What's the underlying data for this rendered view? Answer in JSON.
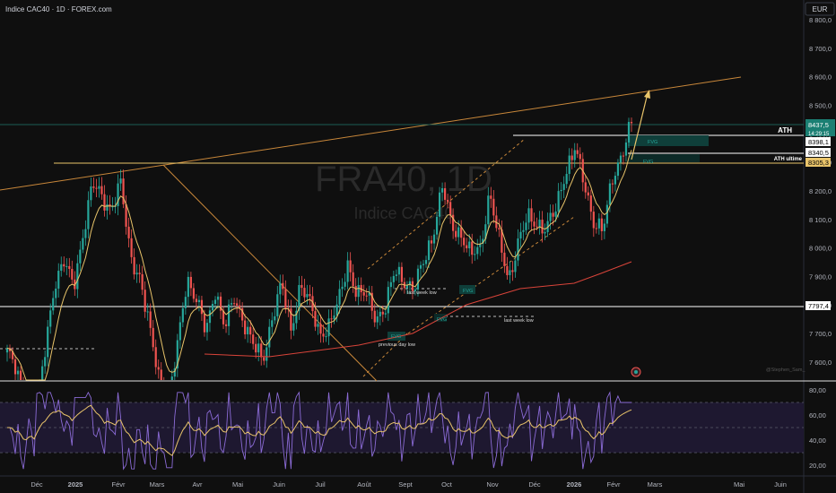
{
  "header": {
    "symbol_title": "Indice CAC40 · 1D · FOREX.com",
    "currency": "EUR"
  },
  "watermark": {
    "symbol": "FRA40, 1D",
    "name": "Indice CAC40"
  },
  "credit": "@Stephen_Sam_",
  "colors": {
    "bg": "#0f0f0f",
    "up": "#26a69a",
    "down": "#ef5350",
    "ma_fast": "#e9c46a",
    "ma_slow": "#d9443a",
    "trend": "#c8873a",
    "level": "#ffffff",
    "ath_line": "#e9c46a",
    "rsi": "#8b6bd6",
    "rsi_ma": "#e9c46a",
    "rsi_band": "#2a2140",
    "badge_green": "#1b7f73"
  },
  "chart_data": [
    {
      "type": "candlestick",
      "title": "FRA40, 1D",
      "y_axis_ticks": [
        "8 800,0",
        "8 700,0",
        "8 600,0",
        "8 500,0",
        "8 400,0",
        "8 300,0",
        "8 200,0",
        "8 100,0",
        "8 000,0",
        "7 900,0",
        "7 800,0",
        "7 700,0",
        "7 600,0"
      ],
      "x_axis_ticks": [
        "Déc",
        "2025",
        "Févr",
        "Mars",
        "Avr",
        "Mai",
        "Juin",
        "Juil",
        "Août",
        "Sept",
        "Oct",
        "Nov",
        "Déc",
        "2026",
        "Févr",
        "Mars",
        "Mai",
        "Juin"
      ],
      "ylim": [
        7535,
        8820
      ],
      "price_labels": [
        {
          "text": "8437,5",
          "value": 8437.5,
          "color": "#26a69a"
        },
        {
          "text": "14:29:15",
          "value": 8412,
          "color": "#26a69a"
        },
        {
          "text": "8398,1",
          "value": 8398.1,
          "color": "#ffffff"
        },
        {
          "text": "8340,5",
          "value": 8340.5,
          "color": "#ffffff"
        },
        {
          "text": "8305,3",
          "value": 8305.3,
          "color": "#e9c46a"
        },
        {
          "text": "7797,4",
          "value": 7797.4,
          "color": "#ffffff"
        }
      ],
      "horizontal_levels": [
        {
          "label": "ATH",
          "value": 8398.1
        },
        {
          "label": "ATH ultime",
          "value": 8340.5
        },
        {
          "label": "",
          "value": 8305.3
        },
        {
          "label": "",
          "value": 7797.4
        }
      ],
      "annotations": [
        {
          "text": "last week low",
          "value": 7855
        },
        {
          "text": "last week low",
          "value": 7765
        },
        {
          "text": "previous day low",
          "value": 7660
        },
        {
          "text": "FVG",
          "value": 8380
        },
        {
          "text": "FVG",
          "value": 8310
        },
        {
          "text": "FVG",
          "value": 7860
        },
        {
          "text": "FVG",
          "value": 7780
        },
        {
          "text": "FVG",
          "value": 7690
        }
      ],
      "close_series": [
        7640,
        7560,
        7460,
        7380,
        7640,
        7880,
        7950,
        7860,
        8050,
        8220,
        8180,
        8140,
        8220,
        7980,
        7900,
        7720,
        7560,
        7450,
        7650,
        7900,
        7820,
        7700,
        7860,
        7720,
        7820,
        7750,
        7660,
        7600,
        7760,
        7870,
        7710,
        7880,
        7800,
        7700,
        7730,
        7800,
        7950,
        7840,
        7830,
        7760,
        7790,
        7920,
        7890,
        7850,
        7950,
        8050,
        8210,
        8080,
        8050,
        7970,
        8000,
        8200,
        8020,
        7890,
        8020,
        8100,
        8090,
        8070,
        8130,
        8270,
        8350,
        8220,
        8100,
        8060,
        8240,
        8340,
        8437.5
      ]
    },
    {
      "type": "line",
      "title": "RSI",
      "y_axis_ticks": [
        "80,00",
        "60,00",
        "40,00",
        "20,00"
      ],
      "ylim": [
        15,
        82
      ],
      "series": []
    }
  ]
}
